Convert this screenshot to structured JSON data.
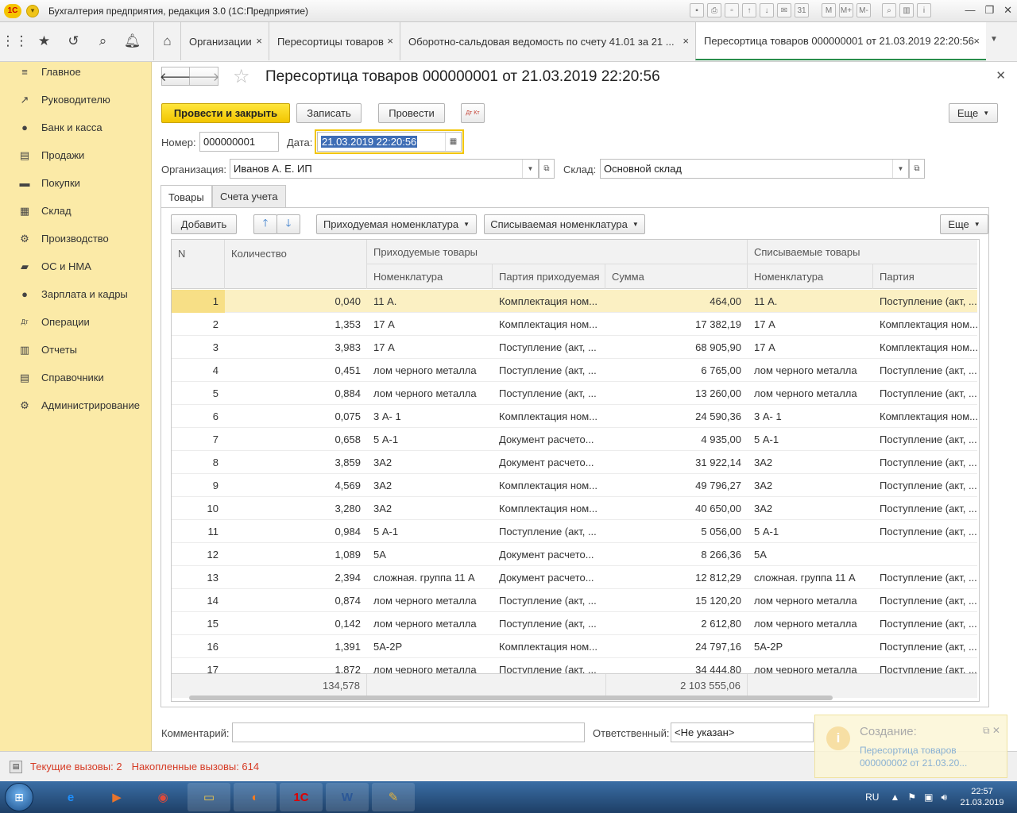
{
  "app": {
    "title": "Бухгалтерия предприятия, редакция 3.0  (1С:Предприятие)",
    "logo": "1С"
  },
  "window_icons": [
    "save-icon",
    "print-icon",
    "preview-icon",
    "upload-icon",
    "download-icon",
    "mail-icon",
    "calendar-icon",
    "memory-icon",
    "memory-plus-icon",
    "memory-minus-icon",
    "zoom-icon",
    "panels-icon",
    "info-icon"
  ],
  "window_icon_glyphs": {
    "save-icon": "▪",
    "print-icon": "⎙",
    "preview-icon": "▫",
    "upload-icon": "↑",
    "download-icon": "↓",
    "mail-icon": "✉",
    "calendar-icon": "31",
    "memory-icon": "M",
    "memory-plus-icon": "M+",
    "memory-minus-icon": "M-",
    "zoom-icon": "⌕",
    "panels-icon": "▥",
    "info-icon": "i"
  },
  "open_tabs": [
    {
      "label": "Организации",
      "close": "×"
    },
    {
      "label": "Пересортицы товаров",
      "close": "×"
    },
    {
      "label": "Оборотно-сальдовая ведомость по счету 41.01 за 21 ...",
      "close": "×"
    },
    {
      "label": "Пересортица товаров 000000001 от 21.03.2019 22:20:56",
      "close": "×"
    }
  ],
  "sidebar": {
    "items": [
      {
        "label": "Главное",
        "icon": "≡"
      },
      {
        "label": "Руководителю",
        "icon": "↗"
      },
      {
        "label": "Банк и касса",
        "icon": "●"
      },
      {
        "label": "Продажи",
        "icon": "▤"
      },
      {
        "label": "Покупки",
        "icon": "▬"
      },
      {
        "label": "Склад",
        "icon": "▦"
      },
      {
        "label": "Производство",
        "icon": "⚙"
      },
      {
        "label": "ОС и НМА",
        "icon": "▰"
      },
      {
        "label": "Зарплата и кадры",
        "icon": "●"
      },
      {
        "label": "Операции",
        "icon": "Дт"
      },
      {
        "label": "Отчеты",
        "icon": "▥"
      },
      {
        "label": "Справочники",
        "icon": "▤"
      },
      {
        "label": "Администрирование",
        "icon": "⚙"
      }
    ]
  },
  "document": {
    "title": "Пересортица товаров 000000001 от 21.03.2019 22:20:56"
  },
  "toolbar": {
    "post_close": "Провести и закрыть",
    "save": "Записать",
    "post": "Провести",
    "dtkt": "Дт Кт",
    "more": "Еще"
  },
  "form": {
    "number_label": "Номер:",
    "number": "000000001",
    "date_label": "Дата:",
    "date": "21.03.2019 22:20:56",
    "org_label": "Организация:",
    "org": "Иванов А. Е. ИП",
    "warehouse_label": "Склад:",
    "warehouse": "Основной склад"
  },
  "doc_tabs": [
    "Товары",
    "Счета учета"
  ],
  "table_toolbar": {
    "add": "Добавить",
    "incoming": "Приходуемая номенклатура",
    "outgoing": "Списываемая номенклатура",
    "more": "Еще"
  },
  "table": {
    "headers": {
      "n": "N",
      "qty": "Количество",
      "in_group": "Приходуемые товары",
      "in_nom": "Номенклатура",
      "in_batch": "Партия приходуемая",
      "sum": "Сумма",
      "out_group": "Списываемые товары",
      "out_nom": "Номенклатура",
      "out_batch": "Партия"
    },
    "rows": [
      [
        "1",
        "0,040",
        "11 А.",
        "Комплектация ном...",
        "464,00",
        "11 А.",
        "Поступление (акт, ..."
      ],
      [
        "2",
        "1,353",
        "17 А",
        "Комплектация ном...",
        "17 382,19",
        "17 А",
        "Комплектация ном..."
      ],
      [
        "3",
        "3,983",
        "17 А",
        "Поступление (акт, ...",
        "68 905,90",
        "17 А",
        "Комплектация ном..."
      ],
      [
        "4",
        "0,451",
        " лом черного металла",
        "Поступление (акт, ...",
        "6 765,00",
        " лом черного металла",
        "Поступление (акт, ..."
      ],
      [
        "5",
        "0,884",
        " лом черного металла",
        "Поступление (акт, ...",
        "13 260,00",
        " лом черного металла",
        "Поступление (акт, ..."
      ],
      [
        "6",
        "0,075",
        "3 А- 1",
        "Комплектация ном...",
        "24 590,36",
        "3 А- 1",
        "Комплектация ном..."
      ],
      [
        "7",
        "0,658",
        "5 А-1",
        "Документ расчето...",
        "4 935,00",
        "5 А-1",
        "Поступление (акт, ..."
      ],
      [
        "8",
        "3,859",
        "3А2",
        "Документ расчето...",
        "31 922,14",
        "3А2",
        "Поступление (акт, ..."
      ],
      [
        "9",
        "4,569",
        "3А2",
        "Комплектация ном...",
        "49 796,27",
        "3А2",
        "Поступление (акт, ..."
      ],
      [
        "10",
        "3,280",
        "3А2",
        "Комплектация ном...",
        "40 650,00",
        "3А2",
        "Поступление (акт, ..."
      ],
      [
        "11",
        "0,984",
        "5 А-1",
        "Поступление (акт, ...",
        "5 056,00",
        "5 А-1",
        "Поступление (акт, ..."
      ],
      [
        "12",
        "1,089",
        "5А",
        "Документ расчето...",
        "8 266,36",
        "5А",
        ""
      ],
      [
        "13",
        "2,394",
        "сложная. группа 11 А",
        "Документ расчето...",
        "12 812,29",
        "сложная. группа 11 А",
        "Поступление (акт, ..."
      ],
      [
        "14",
        "0,874",
        " лом черного металла",
        "Поступление (акт, ...",
        "15 120,20",
        " лом черного металла",
        "Поступление (акт, ..."
      ],
      [
        "15",
        "0,142",
        " лом черного металла",
        "Поступление (акт, ...",
        "2 612,80",
        " лом черного металла",
        "Поступление (акт, ..."
      ],
      [
        "16",
        "1,391",
        "5А-2Р",
        "Комплектация ном...",
        "24 797,16",
        "5А-2Р",
        "Поступление (акт, ..."
      ],
      [
        "17",
        "1,872",
        " лом черного металла",
        "Поступление (акт, ...",
        "34 444,80",
        " лом черного металла",
        "Поступление (акт, ..."
      ]
    ],
    "totals": {
      "qty": "134,578",
      "sum": "2 103 555,06"
    }
  },
  "bottom": {
    "comment_label": "Комментарий:",
    "responsible_label": "Ответственный:",
    "responsible": "<Не указан>"
  },
  "status": {
    "current": "Текущие вызовы: 2",
    "accumulated": "Накопленные вызовы: 614"
  },
  "notification": {
    "title": "Создание:",
    "link": "Пересортица товаров 000000002 от 21.03.20..."
  },
  "taskbar": {
    "lang": "RU",
    "time": "22:57",
    "date": "21.03.2019",
    "apps": [
      {
        "name": "ie",
        "glyph": "e",
        "color": "#1e90ff"
      },
      {
        "name": "media",
        "glyph": "▶",
        "color": "#e8742c"
      },
      {
        "name": "chrome",
        "glyph": "◉",
        "color": "#e04a3a"
      },
      {
        "name": "explorer",
        "glyph": "▭",
        "color": "#f1c84a"
      },
      {
        "name": "firefox",
        "glyph": "◐",
        "color": "#ff7b1c"
      },
      {
        "name": "onec",
        "glyph": "1С",
        "color": "#e00000"
      },
      {
        "name": "word",
        "glyph": "W",
        "color": "#2b5797"
      },
      {
        "name": "paint",
        "glyph": "✎",
        "color": "#e5b33a"
      }
    ]
  },
  "colors": {
    "accent": "#f2c500",
    "sidebar": "#fbeaa7",
    "status_red": "#d63b25",
    "active_tab_line": "#2a8d4b"
  }
}
